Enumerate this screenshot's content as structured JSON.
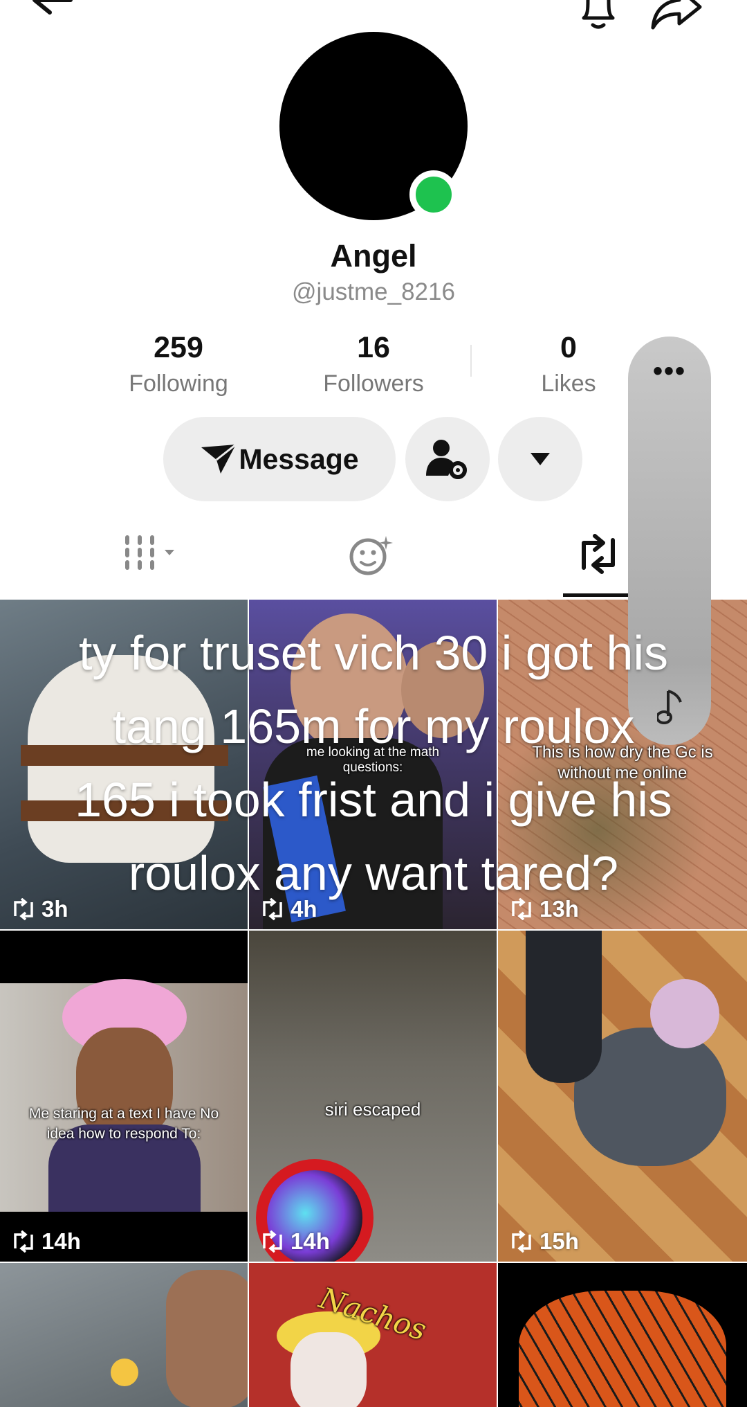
{
  "profile": {
    "display_name": "Angel",
    "handle": "@justme_8216",
    "online": true
  },
  "stats": [
    {
      "value": "259",
      "label": "Following"
    },
    {
      "value": "16",
      "label": "Followers"
    },
    {
      "value": "0",
      "label": "Likes"
    }
  ],
  "actions": {
    "message_label": "Message",
    "icons": [
      "send-icon",
      "user-settings-icon",
      "dropdown-caret-icon"
    ]
  },
  "tabs": [
    {
      "icon": "grid-videos-icon",
      "active": false
    },
    {
      "icon": "favorites-icon",
      "active": false
    },
    {
      "icon": "repost-icon",
      "active": true
    }
  ],
  "side_panel": {
    "more_label": "•••",
    "icon": "music-note-icon"
  },
  "overlay_text": {
    "lines": [
      "ty for truset vich 30 i got his",
      "tang 165m for my roulox",
      "165 i took frist and i give his",
      "roulox  any want tared?"
    ]
  },
  "videos": [
    {
      "time": "3h",
      "caption": ""
    },
    {
      "time": "4h",
      "caption": "me looking at the math questions:"
    },
    {
      "time": "13h",
      "caption": "This is how dry the Gc is without me online"
    },
    {
      "time": "14h",
      "caption": "Me staring at a text I have No idea how to respond To:"
    },
    {
      "time": "14h",
      "caption": "siri escaped"
    },
    {
      "time": "15h",
      "caption": ""
    },
    {
      "time": "",
      "caption": ""
    },
    {
      "time": "",
      "caption": "Nachos"
    },
    {
      "time": "",
      "caption": ""
    }
  ],
  "colors": {
    "online": "#1ec24f",
    "button_bg": "#ededed",
    "muted_text": "#777777"
  }
}
